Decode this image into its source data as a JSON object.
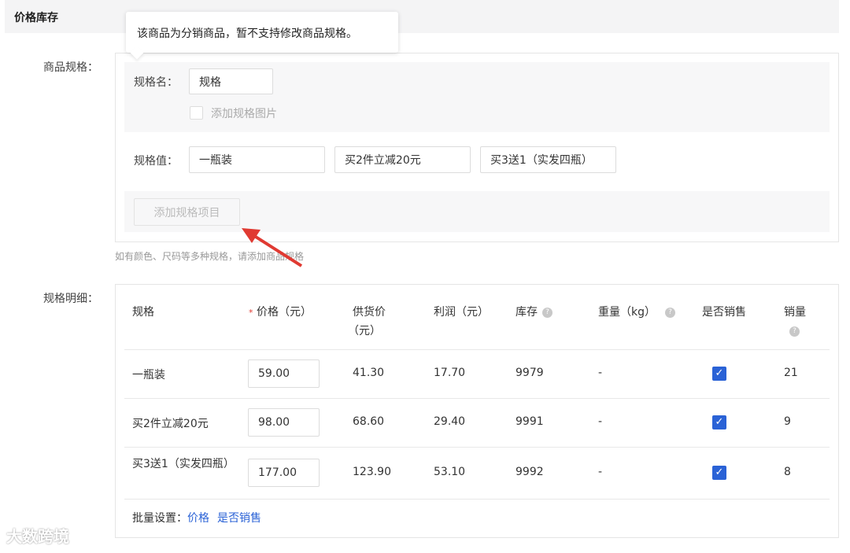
{
  "section_title": "价格库存",
  "tooltip": "该商品为分销商品，暂不支持修改商品规格。",
  "spec": {
    "label": "商品规格：",
    "name_label": "规格名：",
    "name_value": "规格",
    "add_image_label": "添加规格图片",
    "value_label": "规格值：",
    "values": [
      "一瓶装",
      "买2件立减20元",
      "买3送1（实发四瓶）"
    ],
    "add_item_button": "添加规格项目",
    "hint": "如有颜色、尺码等多种规格，请添加商品规格"
  },
  "detail": {
    "label": "规格明细：",
    "headers": {
      "spec": "规格",
      "required": "*",
      "price": "价格（元）",
      "supply_1": "供货价",
      "supply_2": "（元）",
      "profit": "利润（元）",
      "stock": "库存",
      "weight": "重量（kg）",
      "on_sale": "是否销售",
      "sales": "销量",
      "help": "?"
    },
    "rows": [
      {
        "spec": "一瓶装",
        "price": "59.00",
        "supply": "41.30",
        "profit": "17.70",
        "stock": "9979",
        "weight": "-",
        "on_sale": true,
        "sales": "21"
      },
      {
        "spec": "买2件立减20元",
        "price": "98.00",
        "supply": "68.60",
        "profit": "29.40",
        "stock": "9991",
        "weight": "-",
        "on_sale": true,
        "sales": "9"
      },
      {
        "spec": "买3送1（实发四瓶）",
        "price": "177.00",
        "supply": "123.90",
        "profit": "53.10",
        "stock": "9992",
        "weight": "-",
        "on_sale": true,
        "sales": "8"
      }
    ],
    "batch_label": "批量设置：",
    "batch_price": "价格",
    "batch_on_sale": "是否销售"
  },
  "watermark": "大数跨境",
  "colors": {
    "accent": "#2a62d6",
    "arrow": "#e03a32"
  }
}
